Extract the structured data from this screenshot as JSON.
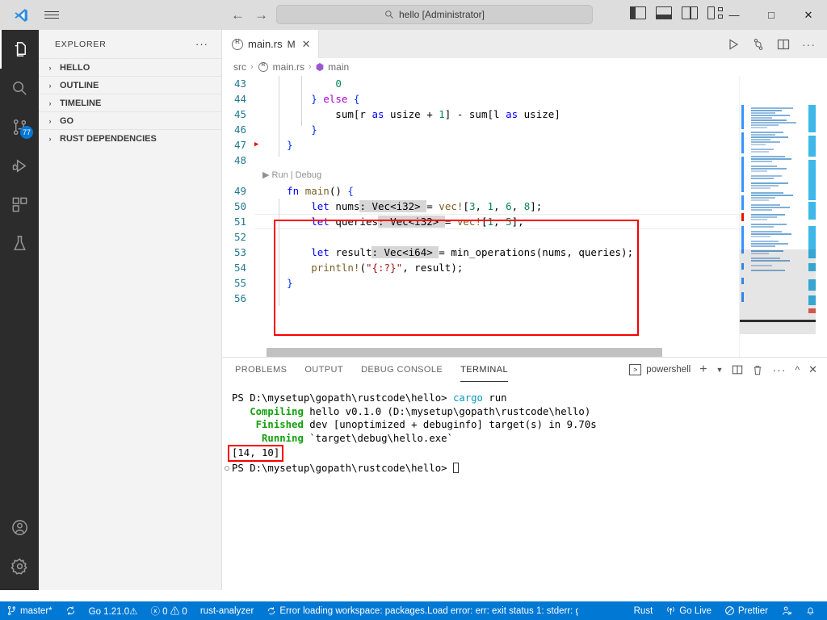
{
  "titlebar": {
    "logo": "vscode-logo",
    "menu_icon": "hamburger-menu-icon",
    "back_arrow": "←",
    "forward_arrow": "→",
    "quick_input_text": "hello [Administrator]",
    "quick_input_icon": "search-icon",
    "layout_toggles": [
      "toggle-primary-sidebar",
      "toggle-panel",
      "toggle-secondary-sidebar",
      "customize-layout"
    ],
    "window_minimize": "—",
    "window_maximize": "□",
    "window_close": "✕"
  },
  "activitybar": {
    "items": [
      {
        "name": "explorer",
        "icon": "files-icon",
        "active": true,
        "badge": ""
      },
      {
        "name": "search",
        "icon": "search-icon",
        "active": false,
        "badge": ""
      },
      {
        "name": "source-control",
        "icon": "source-control-icon",
        "active": false,
        "badge": "77"
      },
      {
        "name": "run-and-debug",
        "icon": "debug-icon",
        "active": false,
        "badge": ""
      },
      {
        "name": "extensions",
        "icon": "extensions-icon",
        "active": false,
        "badge": ""
      },
      {
        "name": "testing",
        "icon": "beaker-icon",
        "active": false,
        "badge": ""
      }
    ],
    "bottom": [
      {
        "name": "accounts",
        "icon": "account-icon"
      },
      {
        "name": "manage",
        "icon": "gear-icon"
      }
    ]
  },
  "sidebar": {
    "title": "EXPLORER",
    "more_actions": "···",
    "sections": [
      {
        "label": "HELLO",
        "expanded": false
      },
      {
        "label": "OUTLINE",
        "expanded": false
      },
      {
        "label": "TIMELINE",
        "expanded": false
      },
      {
        "label": "GO",
        "expanded": false
      },
      {
        "label": "RUST DEPENDENCIES",
        "expanded": false
      }
    ],
    "chevron": "›"
  },
  "editor": {
    "tab": {
      "label": "main.rs",
      "dirty_indicator": "M",
      "close": "✕",
      "icon": "rust-file-icon"
    },
    "actions": [
      "run-icon",
      "debug-alt-icon",
      "split-editor-icon",
      "more-actions-icon"
    ],
    "breadcrumb": [
      "src",
      "main.rs",
      "main"
    ],
    "breadcrumb_separator": "›",
    "codelens": "Run | Debug",
    "lines": [
      {
        "num": "43",
        "indent": 3,
        "tokens": [
          {
            "t": "            ",
            "c": "op"
          },
          {
            "t": "0",
            "c": "num"
          }
        ]
      },
      {
        "num": "44",
        "indent": 2,
        "tokens": [
          {
            "t": "        ",
            "c": "op"
          },
          {
            "t": "}",
            "c": "brc"
          },
          {
            "t": " ",
            "c": "op"
          },
          {
            "t": "else",
            "c": "kctl"
          },
          {
            "t": " ",
            "c": "op"
          },
          {
            "t": "{",
            "c": "brc"
          }
        ]
      },
      {
        "num": "45",
        "indent": 3,
        "tokens": [
          {
            "t": "            sum[r ",
            "c": "op"
          },
          {
            "t": "as",
            "c": "k"
          },
          {
            "t": " usize + ",
            "c": "op"
          },
          {
            "t": "1",
            "c": "num"
          },
          {
            "t": "] - sum[l ",
            "c": "op"
          },
          {
            "t": "as",
            "c": "k"
          },
          {
            "t": " usize]",
            "c": "op"
          }
        ]
      },
      {
        "num": "46",
        "indent": 2,
        "tokens": [
          {
            "t": "        ",
            "c": "op"
          },
          {
            "t": "}",
            "c": "brc"
          }
        ]
      },
      {
        "num": "47",
        "indent": 1,
        "breakpoint": true,
        "tokens": [
          {
            "t": "    ",
            "c": "op"
          },
          {
            "t": "}",
            "c": "brc"
          }
        ]
      },
      {
        "num": "48",
        "indent": 0,
        "tokens": []
      },
      {
        "num": "49",
        "indent": 0,
        "tokens": [
          {
            "t": "    ",
            "c": "op"
          },
          {
            "t": "fn",
            "c": "k"
          },
          {
            "t": " ",
            "c": "op"
          },
          {
            "t": "main",
            "c": "fn"
          },
          {
            "t": "() ",
            "c": "op"
          },
          {
            "t": "{",
            "c": "brc"
          }
        ]
      },
      {
        "num": "50",
        "indent": 1,
        "current": true,
        "tokens": [
          {
            "t": "        ",
            "c": "op"
          },
          {
            "t": "let",
            "c": "k"
          },
          {
            "t": " nums",
            "c": "op"
          },
          {
            "t": ": Vec<i32> ",
            "c": "hl"
          },
          {
            "t": "= ",
            "c": "op"
          },
          {
            "t": "vec!",
            "c": "mac"
          },
          {
            "t": "[",
            "c": "op"
          },
          {
            "t": "3",
            "c": "num"
          },
          {
            "t": ", ",
            "c": "op"
          },
          {
            "t": "1",
            "c": "num"
          },
          {
            "t": ", ",
            "c": "op"
          },
          {
            "t": "6",
            "c": "num"
          },
          {
            "t": ", ",
            "c": "op"
          },
          {
            "t": "8",
            "c": "num"
          },
          {
            "t": "];",
            "c": "op"
          }
        ]
      },
      {
        "num": "51",
        "indent": 1,
        "tokens": [
          {
            "t": "        ",
            "c": "op"
          },
          {
            "t": "let",
            "c": "k"
          },
          {
            "t": " queries",
            "c": "op"
          },
          {
            "t": ": Vec<i32> ",
            "c": "hl"
          },
          {
            "t": "= ",
            "c": "op"
          },
          {
            "t": "vec!",
            "c": "mac"
          },
          {
            "t": "[",
            "c": "op"
          },
          {
            "t": "1",
            "c": "num"
          },
          {
            "t": ", ",
            "c": "op"
          },
          {
            "t": "5",
            "c": "num"
          },
          {
            "t": "];",
            "c": "op"
          }
        ]
      },
      {
        "num": "52",
        "indent": 1,
        "tokens": []
      },
      {
        "num": "53",
        "indent": 1,
        "tokens": [
          {
            "t": "        ",
            "c": "op"
          },
          {
            "t": "let",
            "c": "k"
          },
          {
            "t": " result",
            "c": "op"
          },
          {
            "t": ": Vec<i64> ",
            "c": "hl"
          },
          {
            "t": "= ",
            "c": "op"
          },
          {
            "t": "min_operations",
            "c": "op"
          },
          {
            "t": "(nums, queries);",
            "c": "op"
          }
        ]
      },
      {
        "num": "54",
        "indent": 1,
        "tokens": [
          {
            "t": "        ",
            "c": "op"
          },
          {
            "t": "println!",
            "c": "mac"
          },
          {
            "t": "(",
            "c": "op"
          },
          {
            "t": "\"{:?}\"",
            "c": "str"
          },
          {
            "t": ", result);",
            "c": "op"
          }
        ]
      },
      {
        "num": "55",
        "indent": 0,
        "tokens": [
          {
            "t": "    ",
            "c": "op"
          },
          {
            "t": "}",
            "c": "brc"
          }
        ]
      },
      {
        "num": "56",
        "indent": 0,
        "tokens": []
      }
    ],
    "highlight_box_label": "main-function-highlight"
  },
  "panel": {
    "tabs": [
      {
        "label": "PROBLEMS",
        "active": false
      },
      {
        "label": "OUTPUT",
        "active": false
      },
      {
        "label": "DEBUG CONSOLE",
        "active": false
      },
      {
        "label": "TERMINAL",
        "active": true
      }
    ],
    "shell_name": "powershell",
    "actions": [
      "new-terminal-icon",
      "terminal-dropdown-icon",
      "split-terminal-icon",
      "kill-terminal-icon",
      "more-actions-icon",
      "maximize-panel-icon",
      "close-panel-icon"
    ],
    "terminal": {
      "lines": [
        {
          "segments": [
            {
              "t": "PS D:\\mysetup\\gopath\\rustcode\\hello> ",
              "c": ""
            },
            {
              "t": "cargo",
              "c": "t-cyan"
            },
            {
              "t": " run",
              "c": ""
            }
          ]
        },
        {
          "segments": [
            {
              "t": "   ",
              "c": ""
            },
            {
              "t": "Compiling",
              "c": "t-green"
            },
            {
              "t": " hello v0.1.0 (D:\\mysetup\\gopath\\rustcode\\hello)",
              "c": ""
            }
          ]
        },
        {
          "segments": [
            {
              "t": "    ",
              "c": ""
            },
            {
              "t": "Finished",
              "c": "t-green"
            },
            {
              "t": " dev [unoptimized + debuginfo] target(s) in 9.70s",
              "c": ""
            }
          ]
        },
        {
          "segments": [
            {
              "t": "     ",
              "c": ""
            },
            {
              "t": "Running",
              "c": "t-green"
            },
            {
              "t": " `target\\debug\\hello.exe`",
              "c": ""
            }
          ]
        },
        {
          "segments": [
            {
              "t": "[14, 10]",
              "c": ""
            }
          ],
          "highlight": true
        },
        {
          "segments": [
            {
              "t": "PS D:\\mysetup\\gopath\\rustcode\\hello> ",
              "c": ""
            }
          ],
          "cursor": true,
          "prompt_marker": true
        }
      ],
      "output_highlight_label": "program-output-highlight"
    }
  },
  "statusbar": {
    "left": [
      {
        "name": "remote-branch",
        "icon": "source-control-icon",
        "text": "master*"
      },
      {
        "name": "sync-changes",
        "icon": "sync-icon",
        "text": ""
      },
      {
        "name": "go-version",
        "icon": "",
        "text": "Go 1.21.0⚠"
      },
      {
        "name": "problems",
        "icon": "error-warning-icon",
        "text": "ⓧ 0 ⚠ 0"
      },
      {
        "name": "rust-analyzer",
        "icon": "",
        "text": "rust-analyzer"
      },
      {
        "name": "go-workspace-error",
        "icon": "sync-spin-icon",
        "text": "Error loading workspace: packages.Load error: err: exit status 1: stderr: g…"
      }
    ],
    "right": [
      {
        "name": "rust-language-mode",
        "icon": "",
        "text": "Rust"
      },
      {
        "name": "go-live",
        "icon": "broadcast-icon",
        "text": "Go Live"
      },
      {
        "name": "prettier",
        "icon": "prettier-icon",
        "text": "Prettier"
      },
      {
        "name": "live-share",
        "icon": "live-share-icon",
        "text": ""
      },
      {
        "name": "notifications",
        "icon": "bell-icon",
        "text": ""
      }
    ]
  }
}
